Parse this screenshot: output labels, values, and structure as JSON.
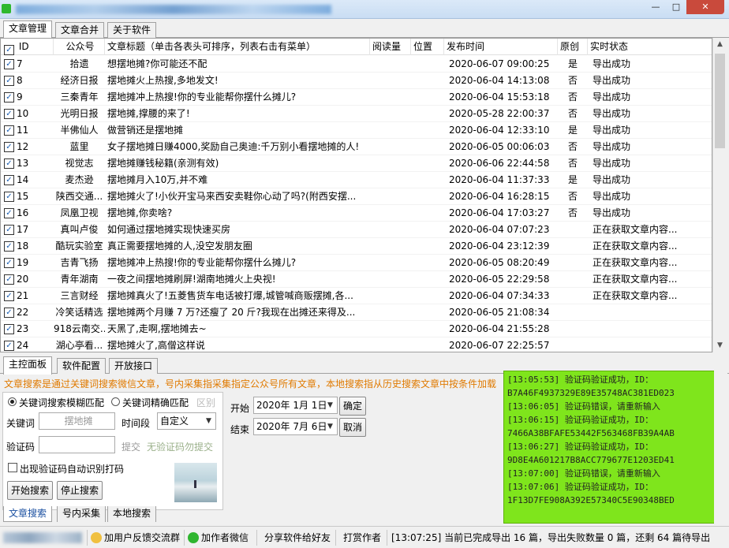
{
  "window": {
    "min": "—",
    "max": "□",
    "close": "✕"
  },
  "top_tabs": [
    "文章管理",
    "文章合并",
    "关于软件"
  ],
  "table": {
    "headers": [
      "ID",
      "公众号",
      "文章标题（单击各表头可排序，列表右击有菜单）",
      "阅读量",
      "位置",
      "发布时间",
      "原创",
      "实时状态"
    ],
    "rows": [
      [
        "7",
        "拾遗",
        "想摆地摊?你可能还不配",
        "",
        "",
        "2020-06-07 09:00:25",
        "是",
        "导出成功"
      ],
      [
        "8",
        "经济日报",
        "摆地摊火上热搜,多地发文!",
        "",
        "",
        "2020-06-04 14:13:08",
        "否",
        "导出成功"
      ],
      [
        "9",
        "三秦青年",
        "摆地摊冲上热搜!你的专业能帮你摆什么摊儿?",
        "",
        "",
        "2020-06-04 15:53:18",
        "否",
        "导出成功"
      ],
      [
        "10",
        "光明日报",
        "摆地摊,撑腰的来了!",
        "",
        "",
        "2020-05-28 22:00:37",
        "否",
        "导出成功"
      ],
      [
        "11",
        "半佛仙人",
        "做营销还是摆地摊",
        "",
        "",
        "2020-06-04 12:33:10",
        "是",
        "导出成功"
      ],
      [
        "12",
        "蓝里",
        "女子摆地摊日赚4000,奖励自己奥迪:千万别小看摆地摊的人!",
        "",
        "",
        "2020-06-05 00:06:03",
        "否",
        "导出成功"
      ],
      [
        "13",
        "视觉志",
        "摆地摊赚钱秘籍(亲测有效)",
        "",
        "",
        "2020-06-06 22:44:58",
        "否",
        "导出成功"
      ],
      [
        "14",
        "麦杰逊",
        "摆地摊月入10万,并不难",
        "",
        "",
        "2020-06-04 11:37:33",
        "是",
        "导出成功"
      ],
      [
        "15",
        "陕西交通...",
        "摆地摊火了!小伙开宝马来西安卖鞋你心动了吗?(附西安摆...",
        "",
        "",
        "2020-06-04 16:28:15",
        "否",
        "导出成功"
      ],
      [
        "16",
        "凤凰卫视",
        "摆地摊,你卖啥?",
        "",
        "",
        "2020-06-04 17:03:27",
        "否",
        "导出成功"
      ],
      [
        "17",
        "真叫卢俊",
        "如何通过摆地摊实现快速买房",
        "",
        "",
        "2020-06-04 07:07:23",
        "",
        "正在获取文章内容..."
      ],
      [
        "18",
        "酷玩实验室",
        "真正需要摆地摊的人,没空发朋友圈",
        "",
        "",
        "2020-06-04 23:12:39",
        "",
        "正在获取文章内容..."
      ],
      [
        "19",
        "吉青飞扬",
        "摆地摊冲上热搜!你的专业能帮你摆什么摊儿?",
        "",
        "",
        "2020-06-05 08:20:49",
        "",
        "正在获取文章内容..."
      ],
      [
        "20",
        "青年湖南",
        "一夜之间摆地摊刷屏!湖南地摊火上央视!",
        "",
        "",
        "2020-06-05 22:29:58",
        "",
        "正在获取文章内容..."
      ],
      [
        "21",
        "三言财经",
        "摆地摊真火了!五菱售货车电话被打爆,城管喊商贩摆摊,各...",
        "",
        "",
        "2020-06-04 07:34:33",
        "",
        "正在获取文章内容..."
      ],
      [
        "22",
        "冷笑话精选",
        "摆地摊两个月赚 7 万?还瘦了 20 斤?我现在出摊还来得及...",
        "",
        "",
        "2020-06-05 21:08:34",
        "",
        ""
      ],
      [
        "23",
        "918云南交...",
        "天黑了,走啊,摆地摊去~",
        "",
        "",
        "2020-06-04 21:55:28",
        "",
        ""
      ],
      [
        "24",
        "湖心亭看...",
        "摆地摊火了,高僧这样说",
        "",
        "",
        "2020-06-07 22:25:57",
        "",
        ""
      ]
    ]
  },
  "bottom_tabs": [
    "主控面板",
    "软件配置",
    "开放接口"
  ],
  "notice": "文章搜索是通过关键词搜索微信文章，号内采集指采集指定公众号所有文章，本地搜索指从历史搜索文章中按条件加载",
  "search": {
    "radio_fuzzy": "关键词搜索模糊匹配",
    "radio_exact": "关键词精确匹配",
    "distinguish": "区别",
    "keyword_label": "关键词",
    "keyword_value": "摆地摊",
    "period_label": "时间段",
    "period_value": "自定义",
    "captcha_label": "验证码",
    "submit": "提交",
    "no_captcha": "无验证码勿提交",
    "auto_captcha": "出现验证码自动识别打码",
    "start_btn": "开始搜索",
    "stop_btn": "停止搜索"
  },
  "date_range": {
    "start_label": "开始",
    "start_date": "2020年 1月 1日",
    "confirm": "确定",
    "end_label": "结束",
    "end_date": "2020年 7月 6日",
    "cancel": "取消"
  },
  "log": [
    "[13:05:53] 验证码验证成功，ID：",
    "B7A46F4937329E89E35748AC381ED023",
    "[13:06:05] 验证码错误，请重新输入",
    "[13:06:15] 验证码验证成功，ID：",
    "7466A38BFAFE53442F563468FB39A4AB",
    "[13:06:27] 验证码验证成功，ID：",
    "9D8E4A601217B8ACC779677E1203ED41",
    "[13:07:00] 验证码错误，请重新输入",
    "[13:07:06] 验证码验证成功，ID：",
    "1F13D7FE908A392E57340C5E90348BED"
  ],
  "sub_tabs": [
    "文章搜索",
    "号内采集",
    "本地搜索"
  ],
  "status": {
    "feedback": "加用户反馈交流群",
    "wechat": "加作者微信",
    "share": "分享软件给好友",
    "tip": "打赏作者",
    "progress": "[13:07:25] 当前已完成导出 16 篇，导出失败数量 0 篇，还剩 64 篇待导出"
  },
  "colors": {
    "log_bg": "#7fe51c",
    "notice": "#e07a00",
    "status_orange": "#e07a00"
  }
}
